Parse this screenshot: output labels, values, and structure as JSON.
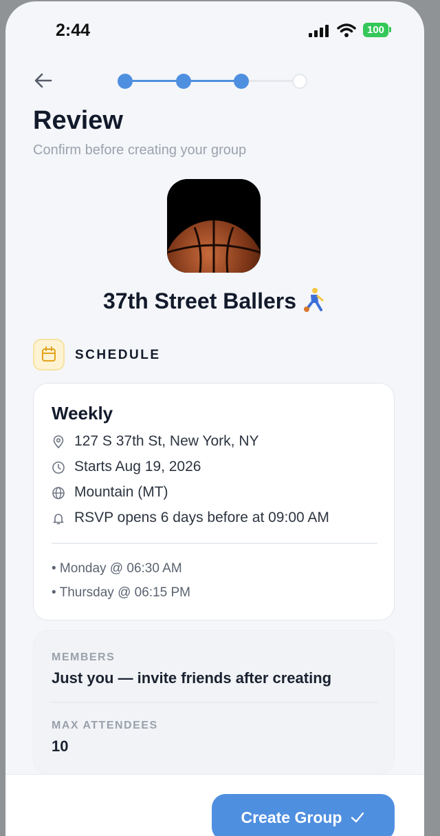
{
  "status_bar": {
    "time": "2:44",
    "battery": "100"
  },
  "stepper": {
    "total_steps": 4,
    "completed_steps": 3
  },
  "header": {
    "title": "Review",
    "subtitle": "Confirm before creating your group"
  },
  "group": {
    "name": "37th Street Ballers",
    "photo_icon": "basketball",
    "emoji": "person-bouncing-ball"
  },
  "schedule": {
    "section_label": "SCHEDULE",
    "frequency": "Weekly",
    "details": [
      {
        "icon": "map-pin-icon",
        "text": "127 S 37th St, New York, NY"
      },
      {
        "icon": "clock-icon",
        "text": "Starts Aug 19, 2026"
      },
      {
        "icon": "globe-icon",
        "text": "Mountain (MT)"
      },
      {
        "icon": "bell-icon",
        "text": "RSVP opens 6 days before at 09:00 AM"
      }
    ],
    "days": [
      "• Monday @ 06:30 AM",
      "• Thursday @ 06:15 PM"
    ]
  },
  "members": {
    "label": "MEMBERS",
    "value": "Just you — invite friends after creating"
  },
  "max_attendees": {
    "label": "MAX ATTENDEES",
    "value": "10"
  },
  "footer": {
    "create_label": "Create Group"
  },
  "colors": {
    "accent": "#4f8fe0",
    "title": "#121a2b",
    "schedule_icon_bg": "#fdf3d3",
    "step_inactive": "#e4e7ec"
  }
}
